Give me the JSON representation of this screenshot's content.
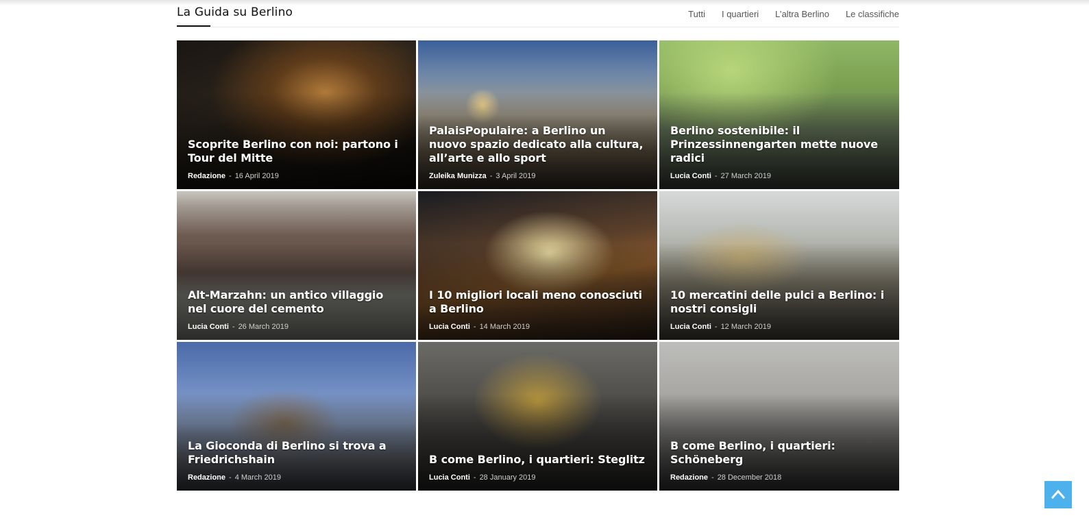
{
  "block": {
    "title": "La Guida su Berlino",
    "filters": [
      "Tutti",
      "I quartieri",
      "L’altra Berlino",
      "Le classifiche"
    ]
  },
  "articles": [
    {
      "title": "Scoprite Berlino con noi: partono i Tour del Mitte",
      "author": "Redazione",
      "date": "16 April 2019"
    },
    {
      "title": "PalaisPopulaire: a Berlino un nuovo spazio dedicato alla cultura, all’arte e allo sport",
      "author": "Zuleika Munizza",
      "date": "3 April 2019"
    },
    {
      "title": "Berlino sostenibile: il Prinzessinnengarten mette nuove radici",
      "author": "Lucia Conti",
      "date": "27 March 2019"
    },
    {
      "title": "Alt-Marzahn: un antico villaggio nel cuore del cemento",
      "author": "Lucia Conti",
      "date": "26 March 2019"
    },
    {
      "title": "I 10 migliori locali meno conosciuti a Berlino",
      "author": "Lucia Conti",
      "date": "14 March 2019"
    },
    {
      "title": "10 mercatini delle pulci a Berlino: i nostri consigli",
      "author": "Lucia Conti",
      "date": "12 March 2019"
    },
    {
      "title": "La Gioconda di Berlino si trova a Friedrichshain",
      "author": "Redazione",
      "date": "4 March 2019"
    },
    {
      "title": "B come Berlino, i quartieri: Steglitz",
      "author": "Lucia Conti",
      "date": "28 January 2019"
    },
    {
      "title": "B come Berlino, i quartieri: Schöneberg",
      "author": "Redazione",
      "date": "28 December 2018"
    }
  ],
  "meta_separator": "-",
  "colors": {
    "accent": "#4db2ec",
    "title_text": "#111111",
    "card_text": "#ffffff"
  },
  "icons": {
    "back_to_top": "chevron-up-icon"
  }
}
